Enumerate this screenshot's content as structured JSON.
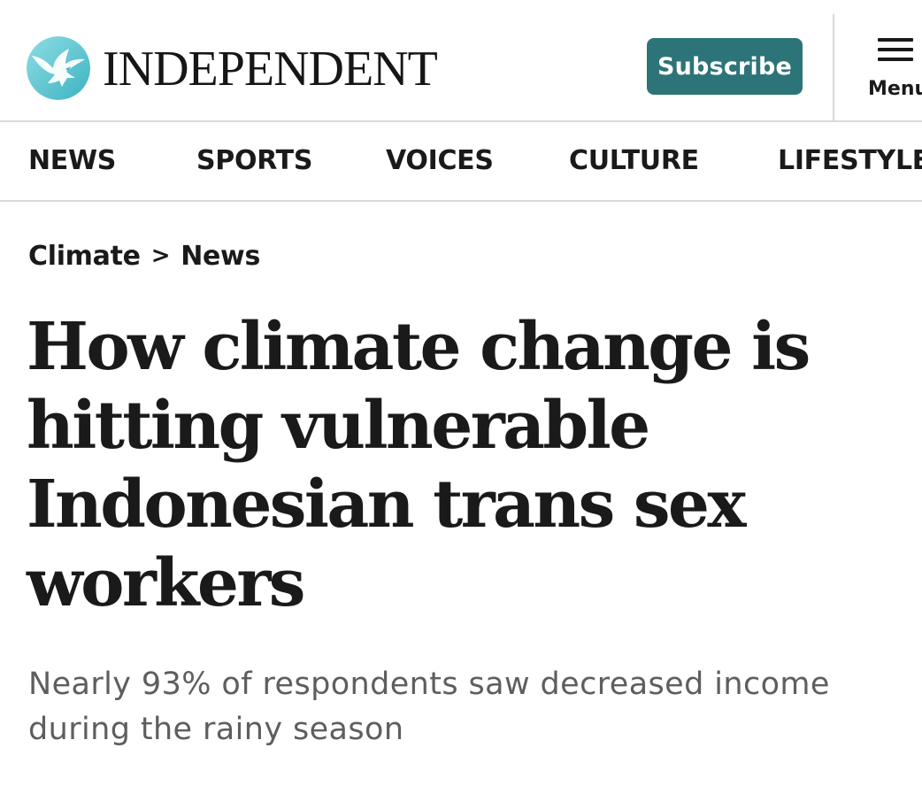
{
  "header": {
    "logo_text": "INDEPENDENT",
    "logo_icon": "eagle-icon",
    "subscribe_label": "Subscribe",
    "menu_label": "Menu",
    "menu_icon": "hamburger-icon"
  },
  "nav": {
    "items": [
      {
        "label": "NEWS"
      },
      {
        "label": "SPORTS"
      },
      {
        "label": "VOICES"
      },
      {
        "label": "CULTURE"
      },
      {
        "label": "LIFESTYLE"
      }
    ]
  },
  "article": {
    "breadcrumb": [
      {
        "label": "Climate"
      },
      {
        "label": "News"
      }
    ],
    "breadcrumb_separator": ">",
    "headline": "How climate change is hitting vulnerable Indonesian trans sex workers",
    "standfirst": "Nearly 93% of respondents saw decreased income during the rainy season"
  },
  "colors": {
    "subscribe_bg": "#2d7479",
    "logo_circle": "#5fc4cf",
    "divider": "#d9d9d9",
    "standfirst_text": "#5e5e5e"
  }
}
